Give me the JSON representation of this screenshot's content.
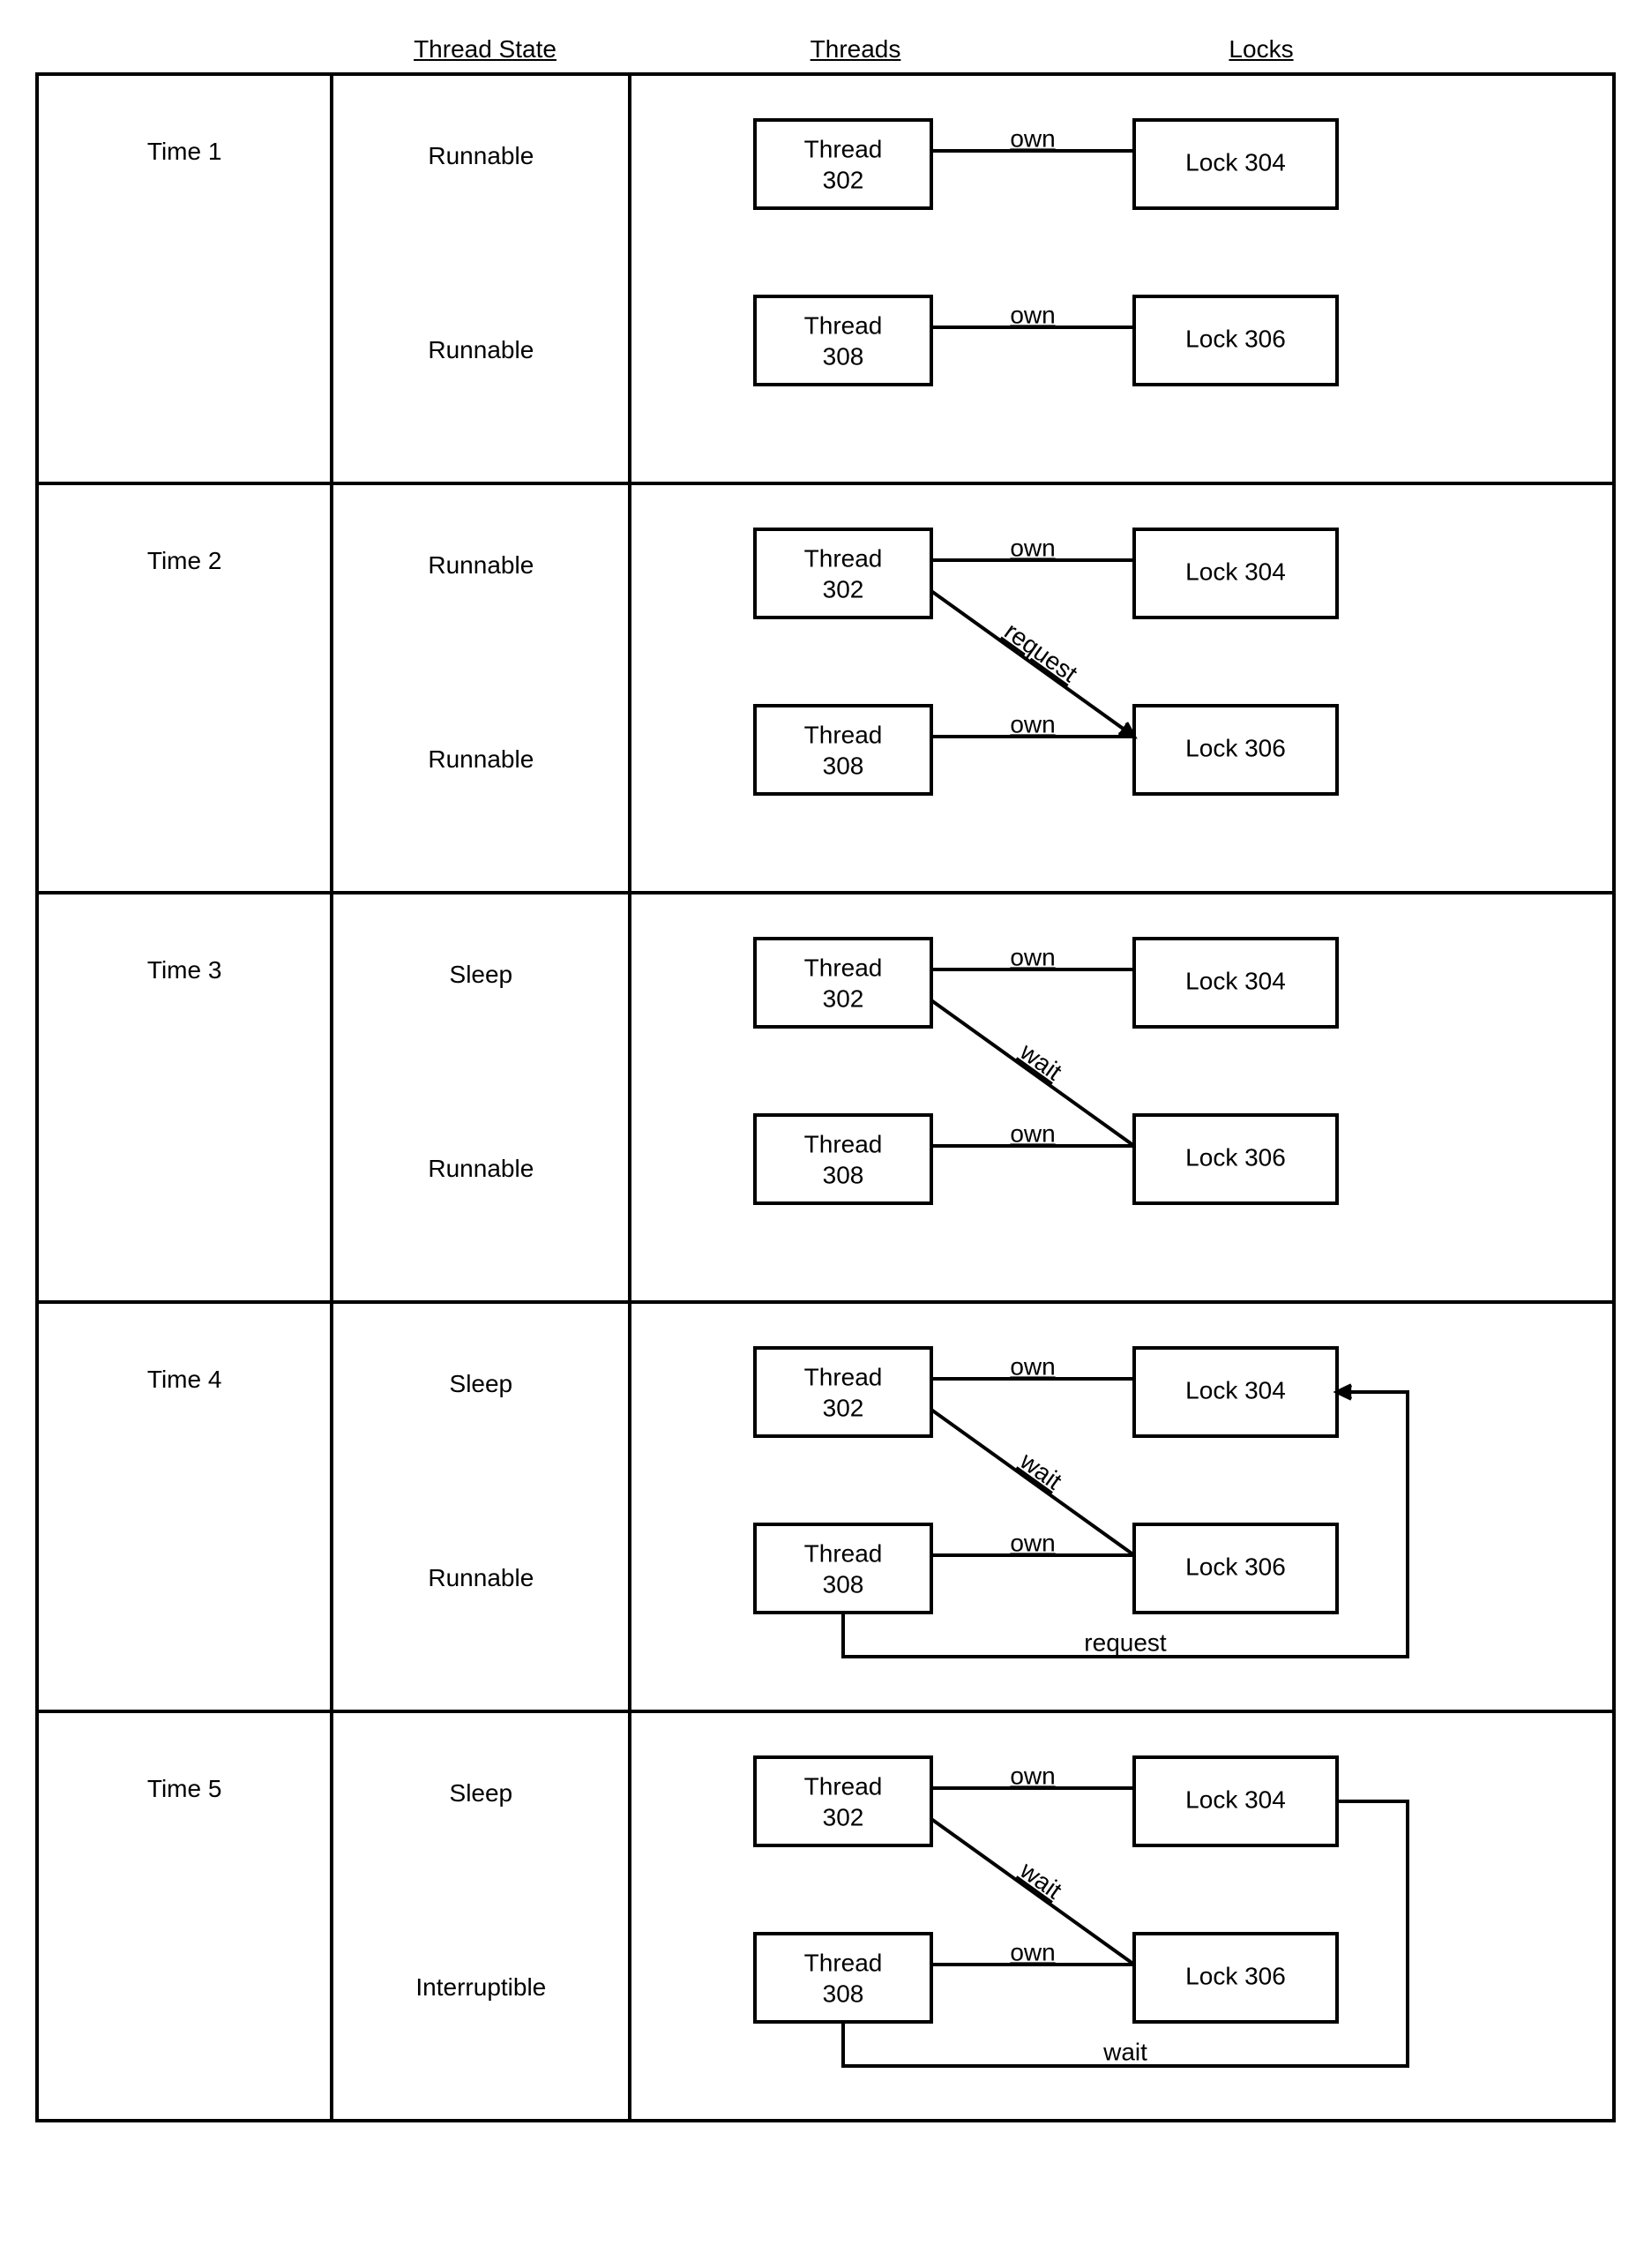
{
  "headers": {
    "state": "Thread State",
    "threads": "Threads",
    "locks": "Locks"
  },
  "rows": [
    {
      "time": "Time 1",
      "state_a": "Runnable",
      "state_b": "Runnable",
      "edges": [
        {
          "from": "thread_a",
          "to": "lock_a",
          "label": "own",
          "arrow": false
        },
        {
          "from": "thread_b",
          "to": "lock_b",
          "label": "own",
          "arrow": false
        }
      ],
      "loopback": null
    },
    {
      "time": "Time 2",
      "state_a": "Runnable",
      "state_b": "Runnable",
      "edges": [
        {
          "from": "thread_a",
          "to": "lock_a",
          "label": "own",
          "arrow": false
        },
        {
          "from": "thread_b",
          "to": "lock_b",
          "label": "own",
          "arrow": false
        },
        {
          "from": "thread_a",
          "to": "lock_b",
          "label": "request",
          "arrow": true
        }
      ],
      "loopback": null
    },
    {
      "time": "Time 3",
      "state_a": "Sleep",
      "state_b": "Runnable",
      "edges": [
        {
          "from": "thread_a",
          "to": "lock_a",
          "label": "own",
          "arrow": false
        },
        {
          "from": "thread_b",
          "to": "lock_b",
          "label": "own",
          "arrow": false
        },
        {
          "from": "thread_a",
          "to": "lock_b",
          "label": "wait",
          "arrow": false
        }
      ],
      "loopback": null
    },
    {
      "time": "Time 4",
      "state_a": "Sleep",
      "state_b": "Runnable",
      "edges": [
        {
          "from": "thread_a",
          "to": "lock_a",
          "label": "own",
          "arrow": false
        },
        {
          "from": "thread_b",
          "to": "lock_b",
          "label": "own",
          "arrow": false
        },
        {
          "from": "thread_a",
          "to": "lock_b",
          "label": "wait",
          "arrow": false
        }
      ],
      "loopback": {
        "from": "thread_b",
        "to": "lock_a",
        "label": "request",
        "arrow": true
      }
    },
    {
      "time": "Time 5",
      "state_a": "Sleep",
      "state_b": "Interruptible",
      "edges": [
        {
          "from": "thread_a",
          "to": "lock_a",
          "label": "own",
          "arrow": false
        },
        {
          "from": "thread_b",
          "to": "lock_b",
          "label": "own",
          "arrow": false
        },
        {
          "from": "thread_a",
          "to": "lock_b",
          "label": "wait",
          "arrow": false
        }
      ],
      "loopback": {
        "from": "thread_b",
        "to": "lock_a",
        "label": "wait",
        "arrow": false
      }
    }
  ],
  "nodes": {
    "thread_a": {
      "line1": "Thread",
      "line2": "302"
    },
    "thread_b": {
      "line1": "Thread",
      "line2": "308"
    },
    "lock_a": {
      "text": "Lock 304"
    },
    "lock_b": {
      "text": "Lock 306"
    }
  }
}
